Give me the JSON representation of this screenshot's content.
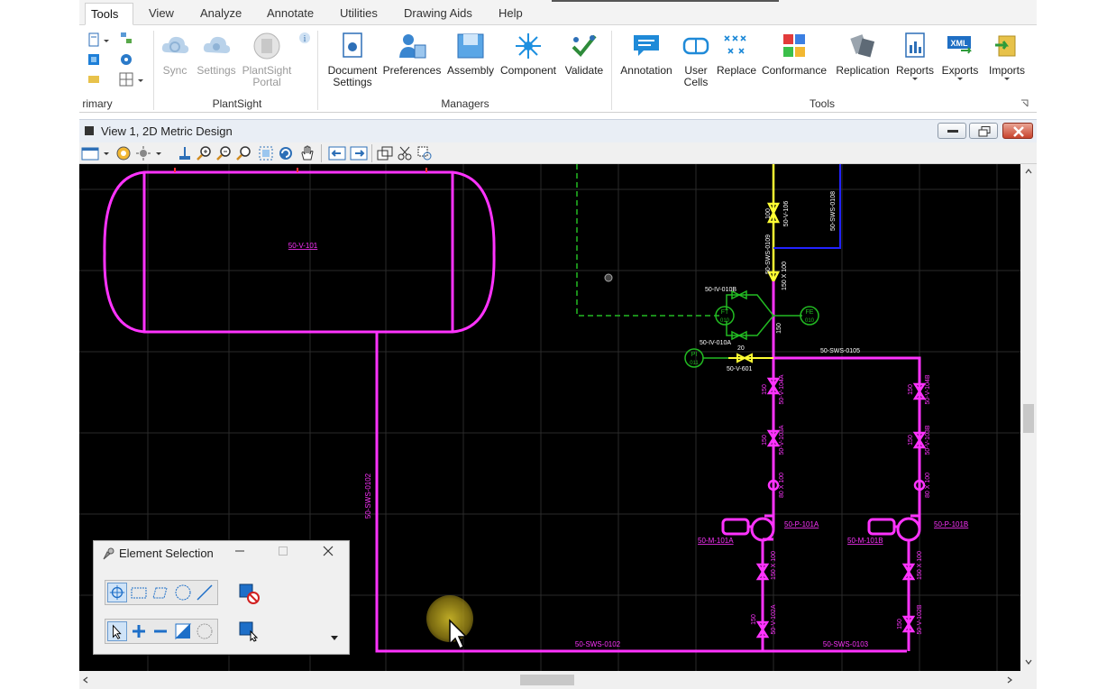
{
  "ribbon_tabs": [
    "Tools",
    "View",
    "Analyze",
    "Annotate",
    "Utilities",
    "Drawing Aids",
    "Help"
  ],
  "active_tab": "Tools",
  "groups": {
    "primary": "rimary",
    "plantsight": "PlantSight",
    "managers": "Managers",
    "tools": "Tools"
  },
  "buttons": {
    "sync": "Sync",
    "settings": "Settings",
    "plantsight_portal_1": "PlantSight",
    "plantsight_portal_2": "Portal",
    "document_settings_1": "Document",
    "document_settings_2": "Settings",
    "preferences": "Preferences",
    "assembly": "Assembly",
    "component": "Component",
    "validate": "Validate",
    "annotation": "Annotation",
    "user_cells_1": "User",
    "user_cells_2": "Cells",
    "replace": "Replace",
    "conformance": "Conformance",
    "replication": "Replication",
    "reports": "Reports",
    "exports": "Exports",
    "imports": "Imports",
    "xml_badge": "XML"
  },
  "view": {
    "title": "View 1, 2D Metric Design"
  },
  "drawing_labels": {
    "tank": "50-V-101",
    "sws0102": "50-SWS-0102",
    "sws0102b": "50-SWS-0102",
    "sws0103": "50-SWS-0103",
    "sws0105": "50-SWS-0105",
    "sws0108": "50-SWS-0108",
    "sws0109": "50-SWS-0109",
    "v106": "50-V-106",
    "iv010b": "50-IV-010B",
    "iv010a": "50-IV-010A",
    "ft": "FT",
    "ft_num": "010",
    "fe": "FE",
    "fe_num": "010",
    "pi": "PI",
    "pi_num": "011",
    "v601": "50-V-601",
    "p101a": "50-P-101A",
    "p101b": "50-P-101B",
    "m101a": "50-M-101A",
    "m101b": "50-M-101B",
    "v104a": "50-V-104A",
    "v104b": "50-V-104B",
    "v103a": "50-V-103A",
    "v103b": "50-V-103B",
    "v102a": "50-V-102A",
    "v102b": "50-V-102B",
    "size100": "100",
    "size150x100": "150 X 100",
    "size150": "150",
    "size80x100": "80 X 100",
    "size20": "20"
  },
  "element_selection": {
    "title": "Element Selection"
  },
  "colors": {
    "magenta": "#ff33ff",
    "green": "#22bb22",
    "yellow": "#ffff33",
    "blue": "#2222ff",
    "grid": "#333333",
    "canvas": "#000000"
  }
}
